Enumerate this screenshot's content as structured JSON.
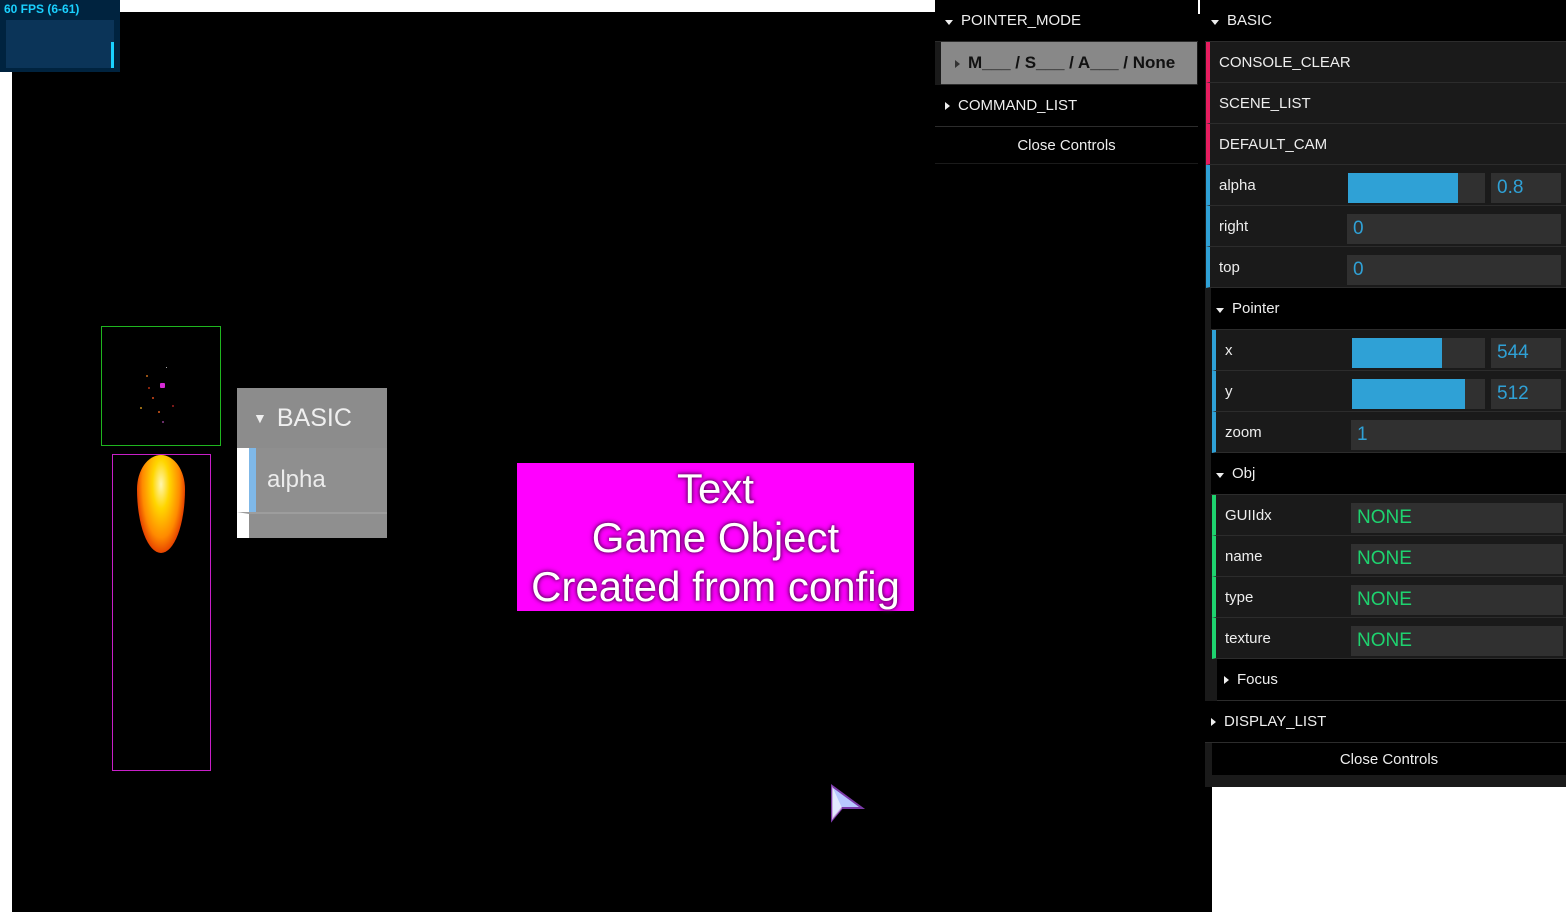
{
  "fps": {
    "label": "60 FPS (6-61)"
  },
  "game": {
    "text_object": {
      "lines": [
        "Text",
        "Game Object",
        "Created from config"
      ]
    },
    "mini_gui": {
      "header": "BASIC",
      "item": "alpha"
    }
  },
  "gui_left": {
    "pointer_mode": "POINTER_MODE",
    "mode_option": "M___ / S___ / A___ / None",
    "command_list": "COMMAND_LIST",
    "close": "Close Controls"
  },
  "gui_right": {
    "basic": "BASIC",
    "console_clear": "CONSOLE_CLEAR",
    "scene_list": "SCENE_LIST",
    "default_cam": "DEFAULT_CAM",
    "alpha": {
      "label": "alpha",
      "value": "0.8",
      "fraction": 0.8
    },
    "right": {
      "label": "right",
      "value": "0"
    },
    "top": {
      "label": "top",
      "value": "0"
    },
    "pointer": "Pointer",
    "x": {
      "label": "x",
      "value": "544",
      "fraction": 0.68
    },
    "y": {
      "label": "y",
      "value": "512",
      "fraction": 0.85
    },
    "zoom": {
      "label": "zoom",
      "value": "1"
    },
    "obj": "Obj",
    "guiidx": {
      "label": "GUIIdx",
      "value": "NONE"
    },
    "name": {
      "label": "name",
      "value": "NONE"
    },
    "type": {
      "label": "type",
      "value": "NONE"
    },
    "texture": {
      "label": "texture",
      "value": "NONE"
    },
    "focus": "Focus",
    "display_list": "DISPLAY_LIST",
    "close": "Close Controls"
  },
  "colors": {
    "accent_red": "#e61d5f",
    "accent_blue": "#2fa1d6",
    "accent_green": "#1ed36f",
    "text_object_bg": "#ff00ff"
  }
}
